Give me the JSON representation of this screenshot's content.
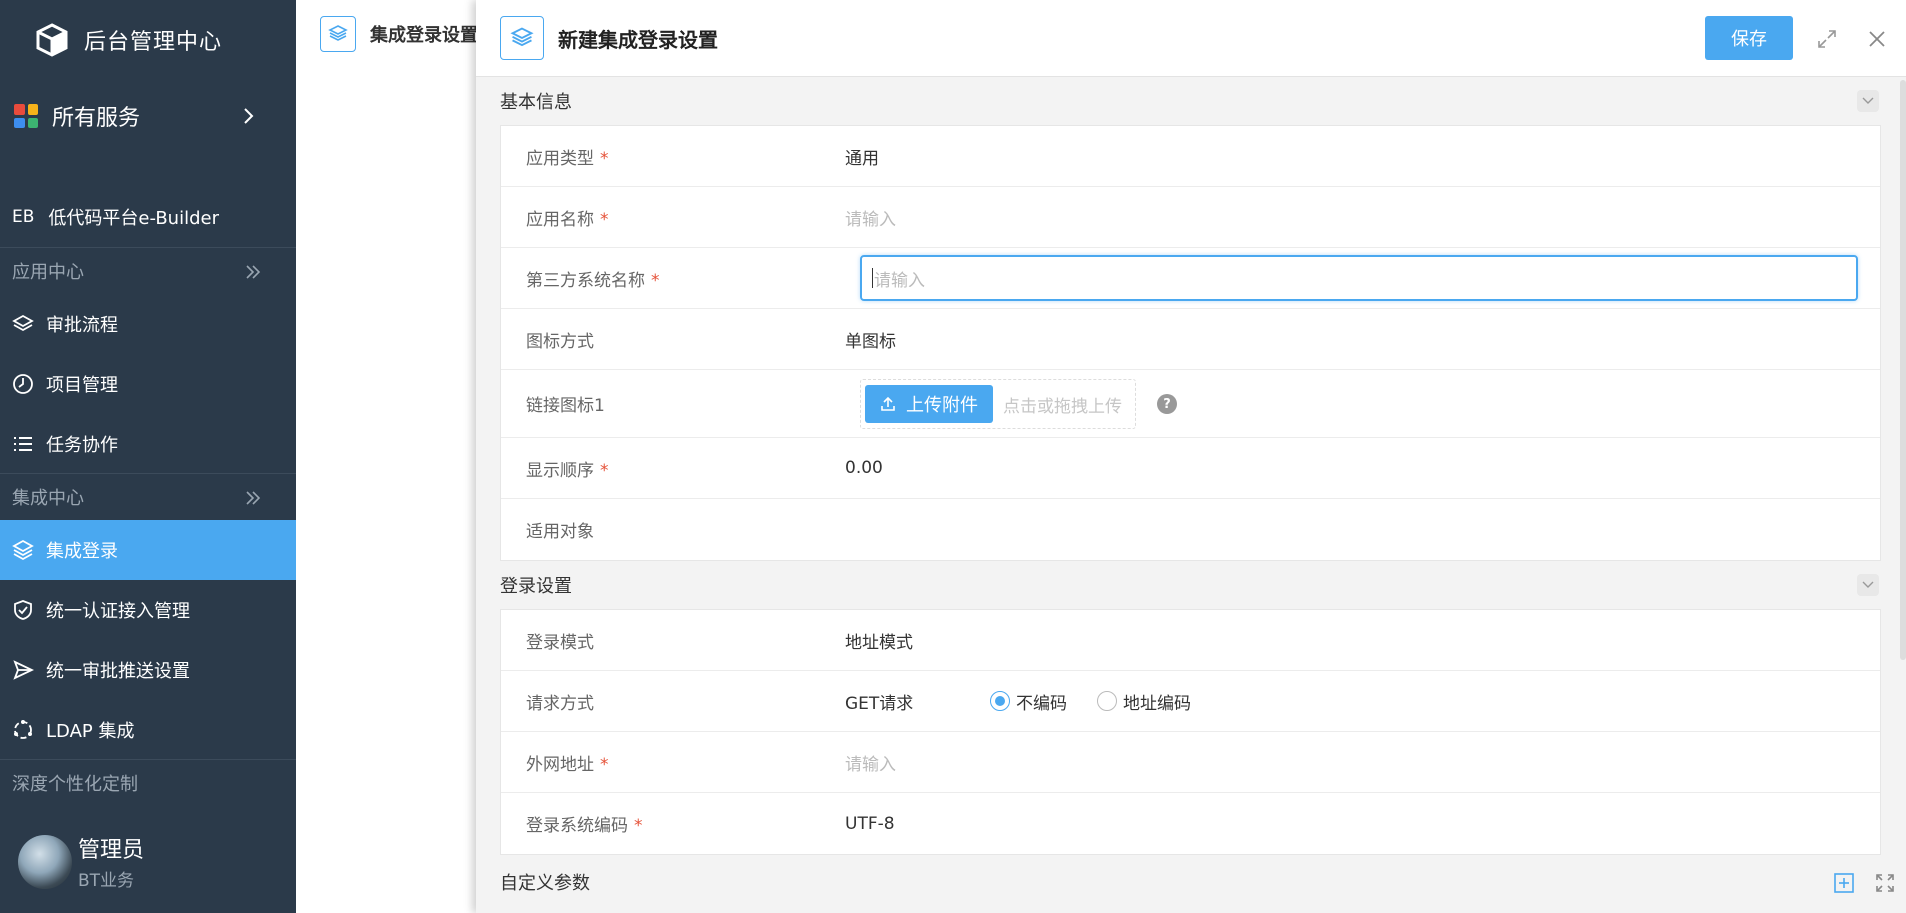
{
  "sidebar": {
    "brand_title": "后台管理中心",
    "all_services": "所有服务",
    "eb_tag": "EB",
    "eb_label": "低代码平台e-Builder",
    "sections": {
      "app_center": "应用中心",
      "integration_center": "集成中心",
      "deep_custom": "深度个性化定制"
    },
    "items": [
      {
        "label": "审批流程",
        "icon": "layers-icon"
      },
      {
        "label": "项目管理",
        "icon": "clock-icon"
      },
      {
        "label": "任务协作",
        "icon": "list-icon"
      },
      {
        "label": "集成登录",
        "icon": "layers-icon",
        "active": true
      },
      {
        "label": "统一认证接入管理",
        "icon": "shield-icon"
      },
      {
        "label": "统一审批推送设置",
        "icon": "send-icon"
      },
      {
        "label": "LDAP 集成",
        "icon": "sync-icon"
      }
    ],
    "user": {
      "name": "管理员",
      "dept": "BT业务"
    }
  },
  "background_tab": {
    "label": "集成登录设置"
  },
  "drawer": {
    "title": "新建集成登录设置",
    "save_label": "保存",
    "basic_group": {
      "title": "基本信息",
      "fields": {
        "app_type": {
          "label": "应用类型",
          "value": "通用"
        },
        "app_name": {
          "label": "应用名称",
          "placeholder": "请输入"
        },
        "third_party_name": {
          "label": "第三方系统名称",
          "placeholder": "请输入"
        },
        "icon_mode": {
          "label": "图标方式",
          "value": "单图标"
        },
        "link_icon": {
          "label": "链接图标1",
          "upload_label": "上传附件",
          "upload_hint": "点击或拖拽上传"
        },
        "display_order": {
          "label": "显示顺序",
          "value": "0.00"
        },
        "applicable": {
          "label": "适用对象"
        }
      }
    },
    "login_group": {
      "title": "登录设置",
      "fields": {
        "login_mode": {
          "label": "登录模式",
          "value": "地址模式"
        },
        "request_method": {
          "label": "请求方式",
          "value": "GET请求",
          "options": [
            "不编码",
            "地址编码"
          ],
          "selected": "不编码"
        },
        "external_url": {
          "label": "外网地址",
          "placeholder": "请输入"
        },
        "encoding": {
          "label": "登录系统编码",
          "value": "UTF-8"
        }
      }
    },
    "custom_params": {
      "title": "自定义参数"
    }
  },
  "colors": {
    "sidebar_bg": "#2b3a4a",
    "accent": "#4aa8f0",
    "required": "#e5533a"
  }
}
